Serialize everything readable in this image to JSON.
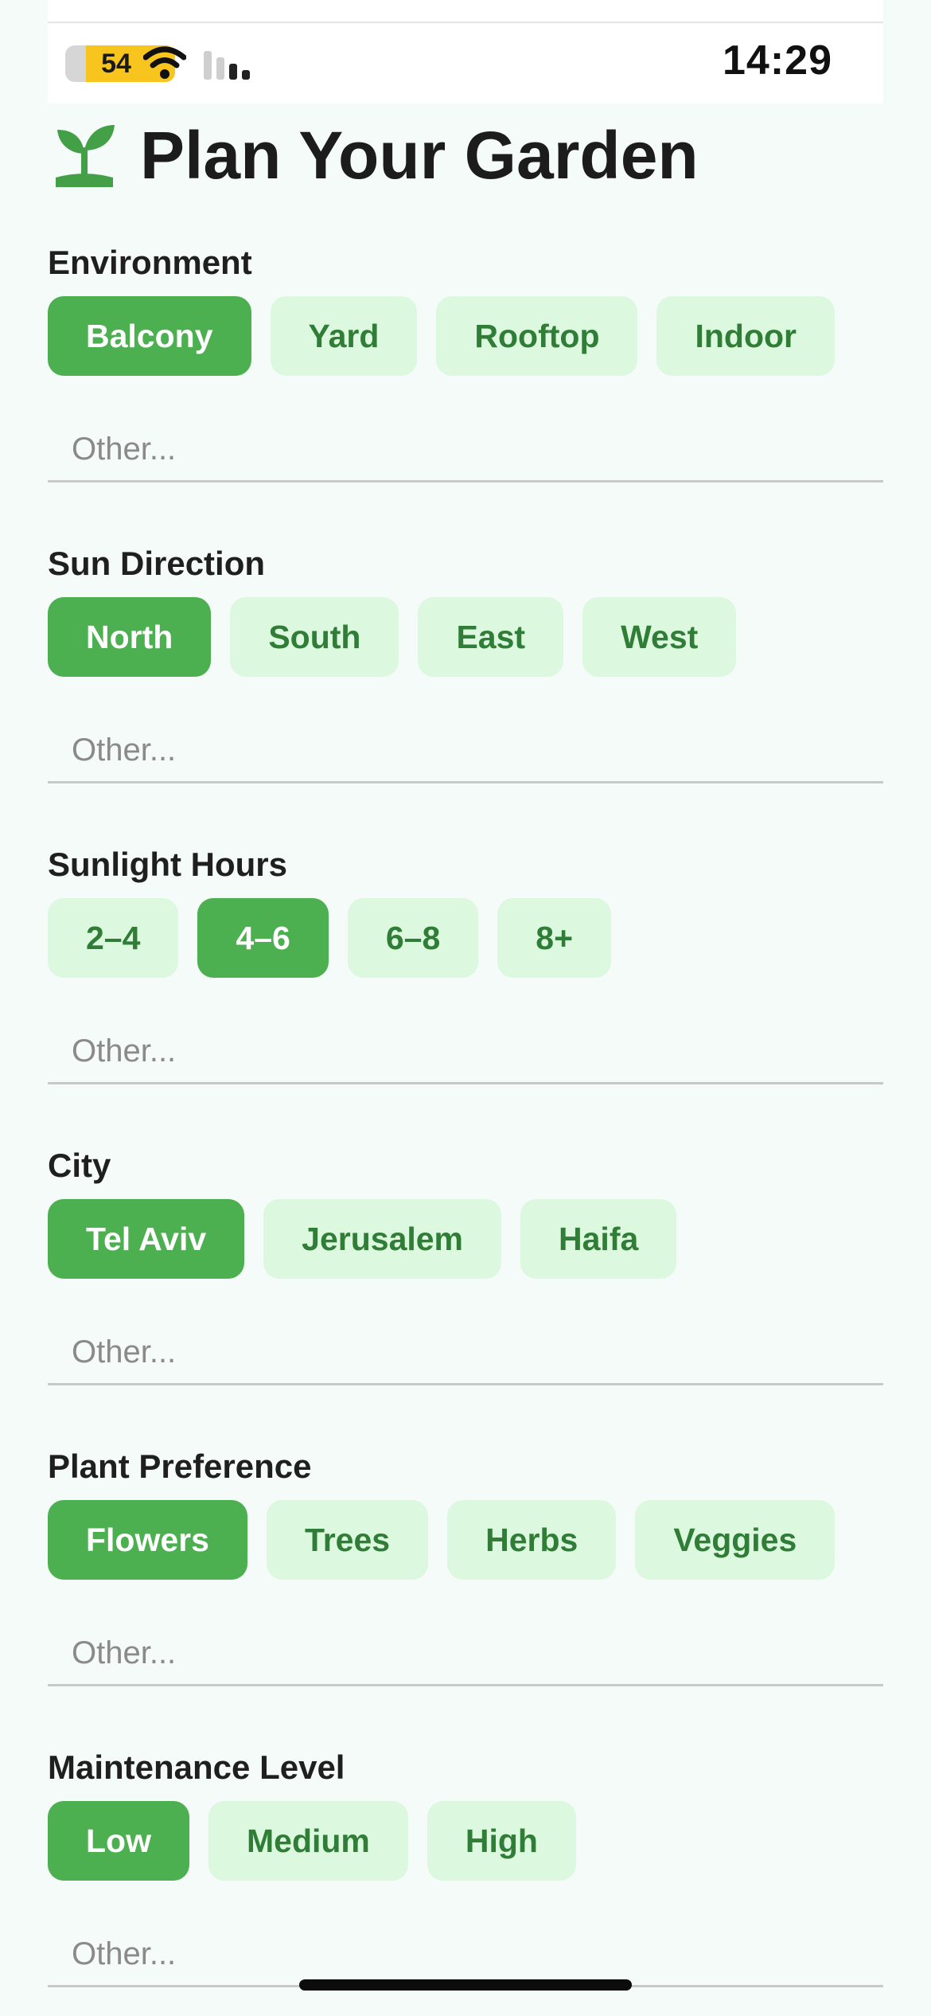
{
  "status_bar": {
    "battery": "54",
    "time": "14:29"
  },
  "header": {
    "title": "Plan Your Garden",
    "icon": "sprout-icon"
  },
  "colors": {
    "accent": "#4caf50",
    "chip_bg": "#dcf8de",
    "chip_text": "#2f7d36"
  },
  "sections": [
    {
      "label": "Environment",
      "options": [
        "Balcony",
        "Yard",
        "Rooftop",
        "Indoor"
      ],
      "selected": "Balcony",
      "other_placeholder": "Other..."
    },
    {
      "label": "Sun Direction",
      "options": [
        "North",
        "South",
        "East",
        "West"
      ],
      "selected": "North",
      "other_placeholder": "Other..."
    },
    {
      "label": "Sunlight Hours",
      "options": [
        "2–4",
        "4–6",
        "6–8",
        "8+"
      ],
      "selected": "4–6",
      "other_placeholder": "Other..."
    },
    {
      "label": "City",
      "options": [
        "Tel Aviv",
        "Jerusalem",
        "Haifa"
      ],
      "selected": "Tel Aviv",
      "other_placeholder": "Other..."
    },
    {
      "label": "Plant Preference",
      "options": [
        "Flowers",
        "Trees",
        "Herbs",
        "Veggies"
      ],
      "selected": "Flowers",
      "other_placeholder": "Other..."
    },
    {
      "label": "Maintenance Level",
      "options": [
        "Low",
        "Medium",
        "High"
      ],
      "selected": "Low",
      "other_placeholder": "Other..."
    }
  ]
}
